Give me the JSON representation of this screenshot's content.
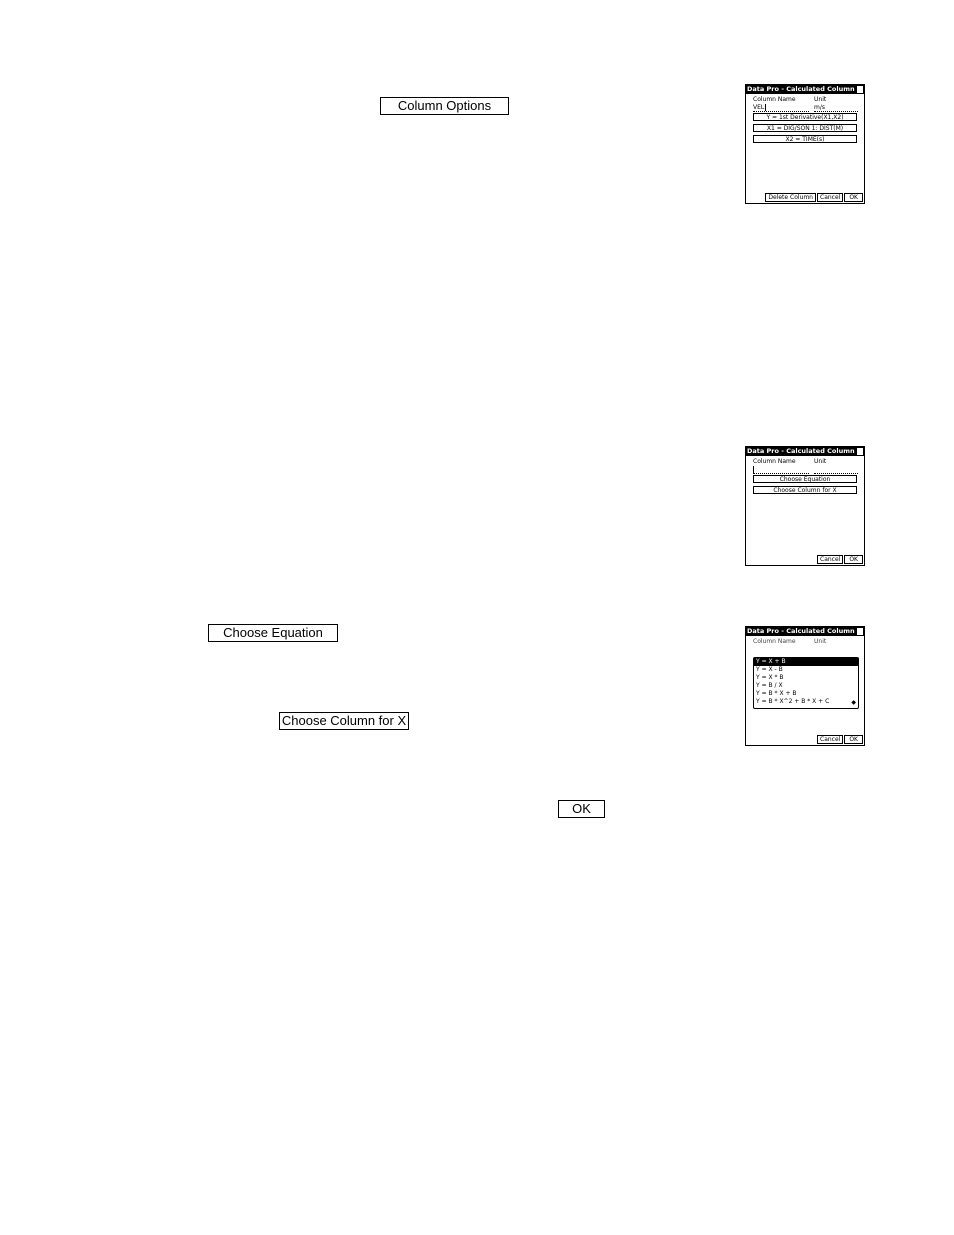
{
  "document": {
    "inline_buttons": {
      "column_options": "Column Options",
      "choose_equation": "Choose Equation",
      "choose_column_for_x": "Choose Column for X",
      "ok": "OK"
    }
  },
  "screens": [
    {
      "title": "Data Pro - Calculated Column",
      "column_name_label": "Column Name",
      "unit_label": "Unit",
      "column_name_value": "VEL",
      "unit_value": "m/s",
      "buttons": [
        "Y = 1st Derivative(X1,X2)",
        "X1 = DIG/SON 1: DIST(M)",
        "X2 = TIME(s)"
      ],
      "footer": [
        "Delete Column",
        "Cancel",
        "OK"
      ]
    },
    {
      "title": "Data Pro - Calculated Column",
      "column_name_label": "Column Name",
      "unit_label": "Unit",
      "column_name_value": "",
      "unit_value": "",
      "buttons": [
        "Choose Equation",
        "Choose Column for X"
      ],
      "footer": [
        "Cancel",
        "OK"
      ]
    },
    {
      "title": "Data Pro - Calculated Column",
      "column_name_label": "Column Name",
      "unit_label": "Unit",
      "equations": [
        "Y = X + B",
        "Y = X - B",
        "Y = X * B",
        "Y = B / X",
        "Y = B * X + B",
        "Y = B * X^2 + B * X + C"
      ],
      "selected_equation": 0,
      "scroll_arrow": "◆",
      "footer": [
        "Cancel",
        "OK"
      ]
    }
  ]
}
